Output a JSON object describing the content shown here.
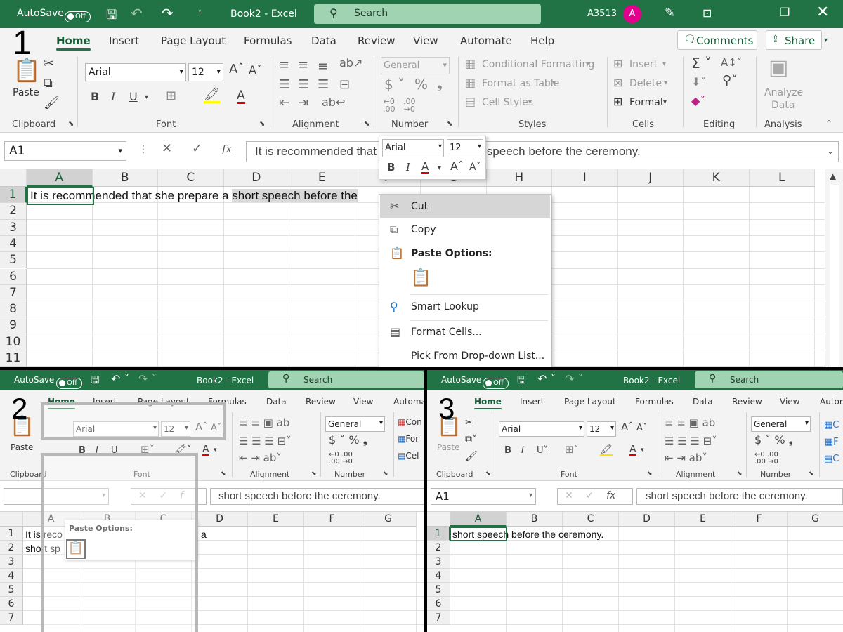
{
  "step_labels": [
    "1",
    "2",
    "3"
  ],
  "colors": {
    "excel_green": "#217346",
    "search_green": "#9fd3b1",
    "avatar": "#e3008c",
    "active_tab": "#185c37"
  },
  "top": {
    "titlebar": {
      "autosave_label": "AutoSave",
      "autosave_state": "Off",
      "title": "Book2 - Excel",
      "search_label": "Search",
      "user": "A3513",
      "avatar_initial": "A"
    },
    "tabs": [
      "Home",
      "Insert",
      "Page Layout",
      "Formulas",
      "Data",
      "Review",
      "View",
      "Automate",
      "Help"
    ],
    "comments_label": "Comments",
    "share_label": "Share",
    "ribbon": {
      "paste": "Paste",
      "font_name": "Arial",
      "font_size": "12",
      "number_format": "General",
      "conditional_formatting": "Conditional Formatting",
      "format_as_table": "Format as Table",
      "cell_styles": "Cell Styles",
      "insert": "Insert",
      "delete": "Delete",
      "format": "Format",
      "analyze_data_1": "Analyze",
      "analyze_data_2": "Data",
      "groups": [
        "Clipboard",
        "Font",
        "Alignment",
        "Number",
        "Styles",
        "Cells",
        "Editing",
        "Analysis"
      ]
    },
    "formula_bar": {
      "name_box": "A1",
      "fx": "fx",
      "content": "It is recommended that she prepare a short speech before the ceremony."
    },
    "columns": [
      "A",
      "B",
      "C",
      "D",
      "E",
      "F",
      "G",
      "H",
      "I",
      "J",
      "K",
      "L"
    ],
    "rows": [
      "1",
      "2",
      "3",
      "4",
      "5",
      "6",
      "7",
      "8",
      "9",
      "10",
      "11"
    ],
    "cell_a1_plain": "It is recommended that she prepare a ",
    "cell_a1_selected": "short speech before the",
    "mini_toolbar": {
      "font": "Arial",
      "size": "12",
      "bold": "B",
      "italic": "I",
      "font_color": "A",
      "grow": "A",
      "shrink": "A"
    },
    "context_menu": {
      "cut": "Cut",
      "copy": "Copy",
      "paste_options": "Paste Options:",
      "smart_lookup": "Smart Lookup",
      "format_cells": "Format Cells...",
      "pick_list": "Pick From Drop-down List..."
    }
  },
  "bottom_left": {
    "titlebar": {
      "autosave_label": "AutoSave",
      "autosave_state": "Off",
      "title": "Book2 - Excel",
      "search_label": "Search"
    },
    "tabs": [
      "Home",
      "Insert",
      "Page Layout",
      "Formulas",
      "Data",
      "Review",
      "View",
      "Automa"
    ],
    "ribbon": {
      "paste": "Paste",
      "font_name": "Arial",
      "font_size": "12",
      "number_format": "General",
      "styles_1": "Con",
      "styles_2": "For",
      "styles_3": "Cel",
      "groups": [
        "Clipboard",
        "Font",
        "Alignment",
        "Number"
      ]
    },
    "formula_bar": {
      "name_box": "",
      "content": "short speech before the ceremony."
    },
    "columns": [
      "A",
      "B",
      "C",
      "D",
      "E",
      "F",
      "G"
    ],
    "rows": [
      "1",
      "2",
      "3",
      "4",
      "5",
      "6",
      "7"
    ],
    "cell_a1": "It is reco",
    "cell_a2": "short sp",
    "cell_d1": "a",
    "paste_options": "Paste Options:"
  },
  "bottom_right": {
    "titlebar": {
      "autosave_label": "AutoSave",
      "autosave_state": "Off",
      "title": "Book2 - Excel",
      "search_label": "Search"
    },
    "tabs": [
      "Home",
      "Insert",
      "Page Layout",
      "Formulas",
      "Data",
      "Review",
      "View",
      "Autom"
    ],
    "ribbon": {
      "paste": "Paste",
      "font_name": "Arial",
      "font_size": "12",
      "number_format": "General",
      "groups": [
        "Clipboard",
        "Font",
        "Alignment",
        "Number"
      ]
    },
    "formula_bar": {
      "name_box": "A1",
      "fx": "fx",
      "content": "short speech before the ceremony."
    },
    "columns": [
      "A",
      "B",
      "C",
      "D",
      "E",
      "F",
      "G"
    ],
    "rows": [
      "1",
      "2",
      "3",
      "4",
      "5",
      "6",
      "7"
    ],
    "cell_a1": "short speech before the ceremony."
  }
}
